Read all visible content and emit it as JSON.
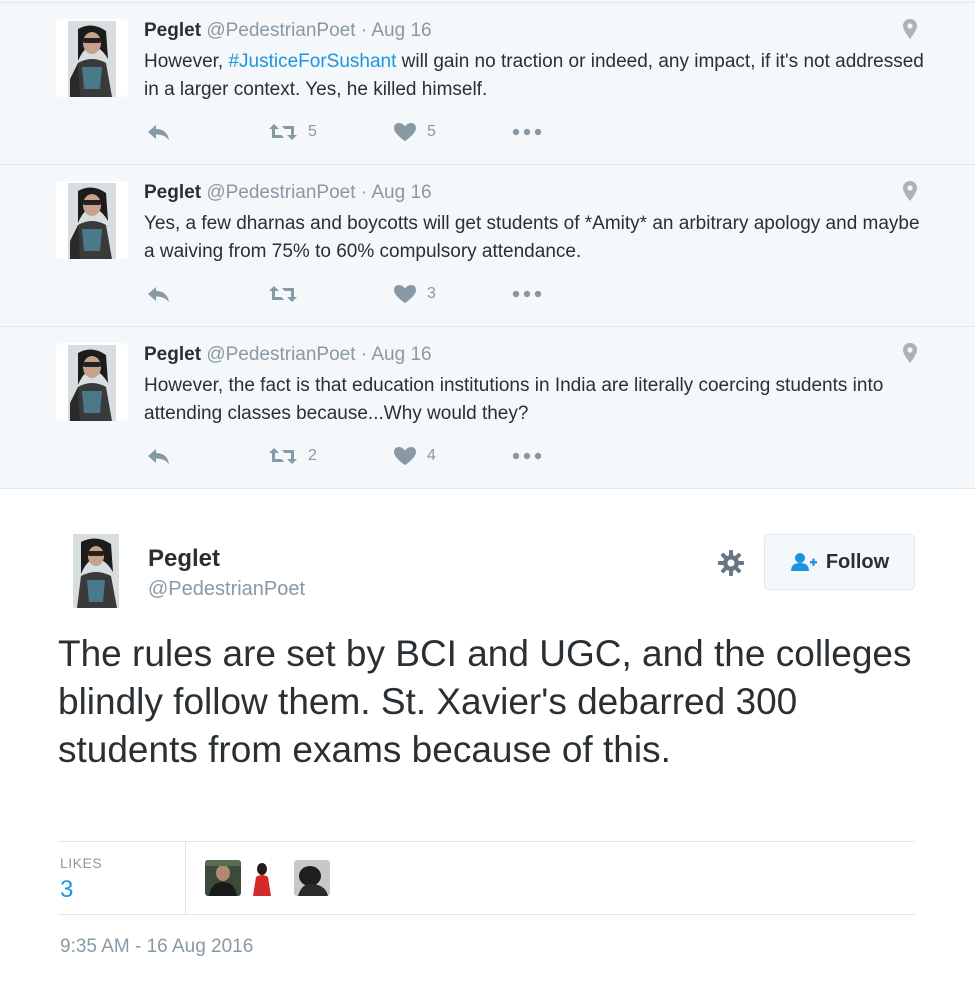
{
  "thread": [
    {
      "author_name": "Peglet",
      "author_handle": "@PedestrianPoet",
      "separator": "·",
      "date": "Aug 16",
      "text_before": "However, ",
      "hashtag": "#JusticeForSushant",
      "text_after": " will gain no traction or indeed, any impact, if it's not addressed in a larger context. Yes, he killed himself.",
      "retweet_count": "5",
      "like_count": "5"
    },
    {
      "author_name": "Peglet",
      "author_handle": "@PedestrianPoet",
      "separator": "·",
      "date": "Aug 16",
      "text_before": "Yes, a few dharnas and boycotts will get students of *Amity* an arbitrary apology and maybe a waiving from 75% to 60% compulsory attendance.",
      "hashtag": "",
      "text_after": "",
      "retweet_count": "",
      "like_count": "3"
    },
    {
      "author_name": "Peglet",
      "author_handle": "@PedestrianPoet",
      "separator": "·",
      "date": "Aug 16",
      "text_before": "However, the fact is that education institutions in India are literally coercing students into attending classes because...Why would they?",
      "hashtag": "",
      "text_after": "",
      "retweet_count": "2",
      "like_count": "4"
    }
  ],
  "main_tweet": {
    "author_name": "Peglet",
    "author_handle": "@PedestrianPoet",
    "follow_label": "Follow",
    "text": "The rules are set by BCI and UGC, and the colleges blindly follow them. St. Xavier's debarred 300 students from exams because of this.",
    "likes_label": "LIKES",
    "likes_count": "3",
    "timestamp": "9:35 AM - 16 Aug 2016"
  },
  "colors": {
    "accent": "#1b95e0",
    "muted": "#8899a6",
    "text": "#292f33",
    "thread_bg": "#f5f8fa",
    "border": "#e1e8ed"
  },
  "icons": {
    "reply": "reply-icon",
    "retweet": "retweet-icon",
    "like": "heart-icon",
    "more": "more-icon",
    "location": "location-pin-icon",
    "settings": "gear-icon",
    "follow": "follow-user-icon"
  }
}
